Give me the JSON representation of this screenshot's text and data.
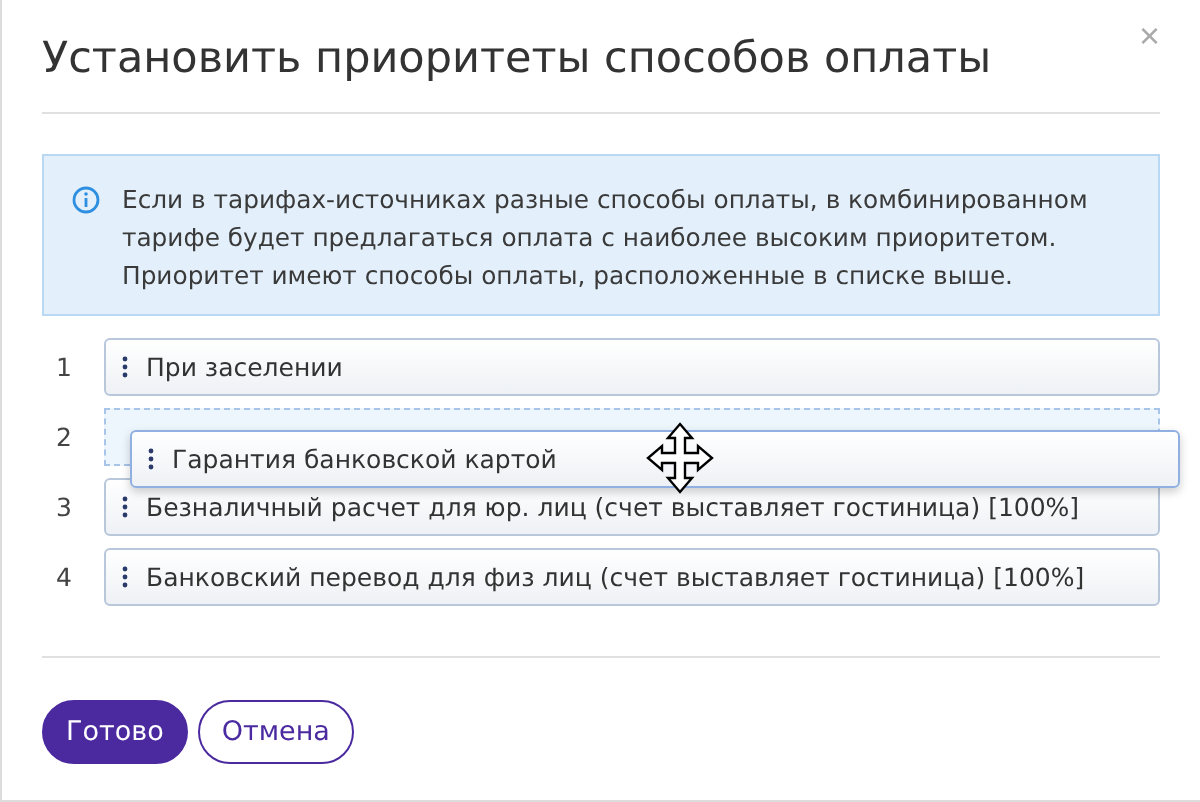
{
  "dialog": {
    "title": "Установить приоритеты способов оплаты",
    "close": "×"
  },
  "info": "Если в тарифах-источниках разные способы оплаты, в комбинированном тарифе будет предлагаться оплата с наиболее высоким приоритетом. Приоритет имеют способы оплаты, расположенные в списке выше.",
  "items": [
    {
      "number": "1",
      "label": "При заселении",
      "dragging": false
    },
    {
      "number": "2",
      "label": "Гарантия банковской картой",
      "dragging": true
    },
    {
      "number": "3",
      "label": "Безналичный расчет для юр. лиц (счет выставляет гостиница) [100%]",
      "dragging": false
    },
    {
      "number": "4",
      "label": "Банковский перевод для физ лиц (счет выставляет гостиница) [100%]",
      "dragging": false
    }
  ],
  "buttons": [
    {
      "label": "Готово",
      "kind": "primary"
    },
    {
      "label": "Отмена",
      "kind": "secondary"
    }
  ]
}
